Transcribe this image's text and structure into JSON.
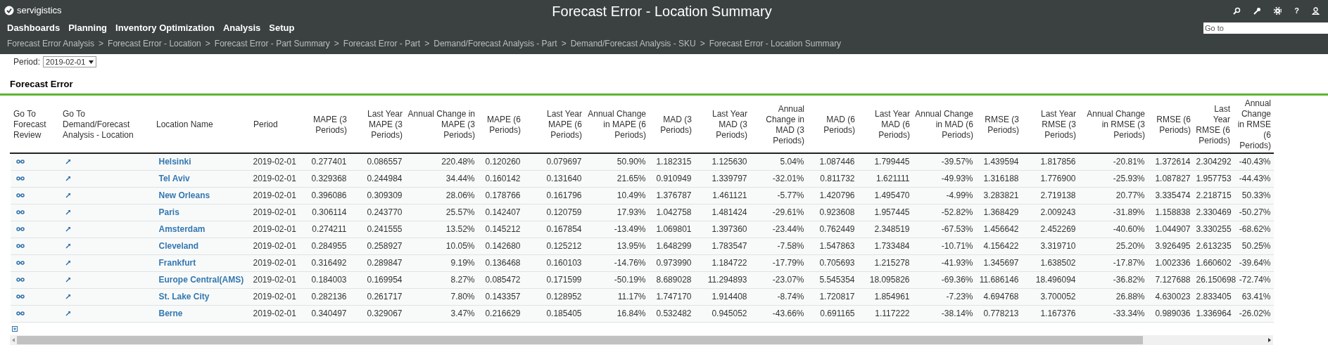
{
  "app": {
    "logo": "servigistics",
    "title": "Forecast Error - Location Summary",
    "help": "?",
    "goto": {
      "placeholder": "Go to"
    }
  },
  "menu": [
    "Dashboards",
    "Planning",
    "Inventory Optimization",
    "Analysis",
    "Setup"
  ],
  "breadcrumb_separator": ">",
  "breadcrumb": [
    "Forecast Error Analysis",
    "Forecast Error - Location",
    "Forecast Error - Part Summary",
    "Forecast Error - Part",
    "Demand/Forecast Analysis - Part",
    "Demand/Forecast Analysis - SKU",
    "Forecast Error - Location Summary"
  ],
  "period": {
    "label": "Period:",
    "value": "2019-02-01"
  },
  "section_title": "Forecast Error",
  "columns": [
    {
      "label": "Go To Forecast Review",
      "kind": "review"
    },
    {
      "label": "Go To Demand/Forecast Analysis - Location",
      "kind": "analysis"
    },
    {
      "label": "Location Name",
      "kind": "link"
    },
    {
      "label": "Period",
      "kind": "text"
    },
    {
      "label": "MAPE (3 Periods)",
      "kind": "number"
    },
    {
      "label": "Last Year MAPE (3 Periods)",
      "kind": "number"
    },
    {
      "label": "Annual Change in MAPE (3 Periods)",
      "kind": "number"
    },
    {
      "label": "MAPE (6 Periods)",
      "kind": "number"
    },
    {
      "label": "Last Year MAPE (6 Periods)",
      "kind": "number"
    },
    {
      "label": "Annual Change in MAPE (6 Periods)",
      "kind": "number"
    },
    {
      "label": "MAD (3 Periods)",
      "kind": "number"
    },
    {
      "label": "Last Year MAD (3 Periods)",
      "kind": "number"
    },
    {
      "label": "Annual Change in MAD (3 Periods)",
      "kind": "number"
    },
    {
      "label": "MAD (6 Periods)",
      "kind": "number"
    },
    {
      "label": "Last Year MAD (6 Periods)",
      "kind": "number"
    },
    {
      "label": "Annual Change in MAD (6 Periods)",
      "kind": "number"
    },
    {
      "label": "RMSE (3 Periods)",
      "kind": "number"
    },
    {
      "label": "Last Year RMSE (3 Periods)",
      "kind": "number"
    },
    {
      "label": "Annual Change in RMSE (3 Periods)",
      "kind": "number"
    },
    {
      "label": "RMSE (6 Periods)",
      "kind": "number"
    },
    {
      "label": "Last Year RMSE (6 Periods)",
      "kind": "number"
    },
    {
      "label": "Annual Change in RMSE (6 Periods)",
      "kind": "number"
    }
  ],
  "rows": [
    {
      "cells": [
        "",
        "",
        "Helsinki",
        "2019-02-01",
        "0.277401",
        "0.086557",
        "220.48%",
        "0.120260",
        "0.079697",
        "50.90%",
        "1.182315",
        "1.125630",
        "5.04%",
        "1.087446",
        "1.799445",
        "-39.57%",
        "1.439594",
        "1.817856",
        "-20.81%",
        "1.372614",
        "2.304292",
        "-40.43%"
      ]
    },
    {
      "cells": [
        "",
        "",
        "Tel Aviv",
        "2019-02-01",
        "0.329368",
        "0.244984",
        "34.44%",
        "0.160142",
        "0.131640",
        "21.65%",
        "0.910949",
        "1.339797",
        "-32.01%",
        "0.811732",
        "1.621111",
        "-49.93%",
        "1.316188",
        "1.776900",
        "-25.93%",
        "1.087827",
        "1.957753",
        "-44.43%"
      ]
    },
    {
      "cells": [
        "",
        "",
        "New Orleans",
        "2019-02-01",
        "0.396086",
        "0.309309",
        "28.06%",
        "0.178766",
        "0.161796",
        "10.49%",
        "1.376787",
        "1.461121",
        "-5.77%",
        "1.420796",
        "1.495470",
        "-4.99%",
        "3.283821",
        "2.719138",
        "20.77%",
        "3.335474",
        "2.218715",
        "50.33%"
      ]
    },
    {
      "cells": [
        "",
        "",
        "Paris",
        "2019-02-01",
        "0.306114",
        "0.243770",
        "25.57%",
        "0.142407",
        "0.120759",
        "17.93%",
        "1.042758",
        "1.481424",
        "-29.61%",
        "0.923608",
        "1.957445",
        "-52.82%",
        "1.368429",
        "2.009243",
        "-31.89%",
        "1.158838",
        "2.330469",
        "-50.27%"
      ]
    },
    {
      "cells": [
        "",
        "",
        "Amsterdam",
        "2019-02-01",
        "0.274211",
        "0.241555",
        "13.52%",
        "0.145212",
        "0.167854",
        "-13.49%",
        "1.069801",
        "1.397360",
        "-23.44%",
        "0.762449",
        "2.348519",
        "-67.53%",
        "1.456642",
        "2.452269",
        "-40.60%",
        "1.044907",
        "3.330255",
        "-68.62%"
      ]
    },
    {
      "cells": [
        "",
        "",
        "Cleveland",
        "2019-02-01",
        "0.284955",
        "0.258927",
        "10.05%",
        "0.142680",
        "0.125212",
        "13.95%",
        "1.648299",
        "1.783547",
        "-7.58%",
        "1.547863",
        "1.733484",
        "-10.71%",
        "4.156422",
        "3.319710",
        "25.20%",
        "3.926495",
        "2.613235",
        "50.25%"
      ]
    },
    {
      "cells": [
        "",
        "",
        "Frankfurt",
        "2019-02-01",
        "0.316492",
        "0.289847",
        "9.19%",
        "0.136468",
        "0.160103",
        "-14.76%",
        "0.973990",
        "1.184722",
        "-17.79%",
        "0.705693",
        "1.215278",
        "-41.93%",
        "1.345697",
        "1.638502",
        "-17.87%",
        "1.002336",
        "1.660602",
        "-39.64%"
      ]
    },
    {
      "cells": [
        "",
        "",
        "Europe Central(AMS)",
        "2019-02-01",
        "0.184003",
        "0.169954",
        "8.27%",
        "0.085472",
        "0.171599",
        "-50.19%",
        "8.689028",
        "11.294893",
        "-23.07%",
        "5.545354",
        "18.095826",
        "-69.36%",
        "11.686146",
        "18.496094",
        "-36.82%",
        "7.127688",
        "26.150698",
        "-72.74%"
      ]
    },
    {
      "cells": [
        "",
        "",
        "St. Lake City",
        "2019-02-01",
        "0.282136",
        "0.261717",
        "7.80%",
        "0.143357",
        "0.128952",
        "11.17%",
        "1.747170",
        "1.914408",
        "-8.74%",
        "1.720817",
        "1.854961",
        "-7.23%",
        "4.694768",
        "3.700052",
        "26.88%",
        "4.630023",
        "2.833405",
        "63.41%"
      ]
    },
    {
      "cells": [
        "",
        "",
        "Berne",
        "2019-02-01",
        "0.340497",
        "0.329067",
        "3.47%",
        "0.216629",
        "0.185405",
        "16.84%",
        "0.532482",
        "0.945052",
        "-43.66%",
        "0.691165",
        "1.117222",
        "-38.14%",
        "0.778213",
        "1.167376",
        "-33.34%",
        "0.989036",
        "1.336964",
        "-26.02%"
      ]
    }
  ]
}
